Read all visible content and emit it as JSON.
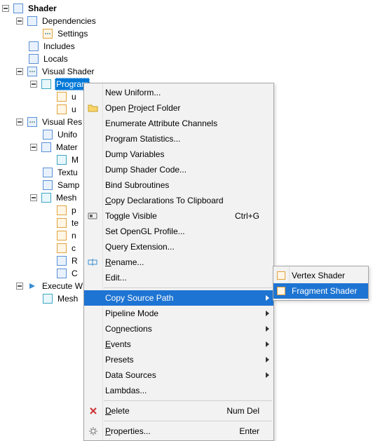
{
  "tree": {
    "root": "Shader",
    "dependencies": "Dependencies",
    "settings": "Settings",
    "includes": "Includes",
    "locals": "Locals",
    "visual_shader": "Visual Shader",
    "program": "Program",
    "u1": "u",
    "u2": "u",
    "visual_res": "Visual Res",
    "unifo": "Unifo",
    "mater": "Mater",
    "m": "M",
    "textu": "Textu",
    "samp": "Samp",
    "mesh1": "Mesh",
    "p": "p",
    "te": "te",
    "n": "n",
    "c": "c",
    "r": "R",
    "cap_c": "C",
    "execute_w": "Execute W",
    "mesh2": "Mesh"
  },
  "menu": {
    "new_uniform": "New Uniform...",
    "open_project_folder_pre": "Open ",
    "open_project_folder_u": "P",
    "open_project_folder_post": "roject Folder",
    "enumerate_attr": "Enumerate Attribute Channels",
    "program_stats": "Program Statistics...",
    "dump_vars": "Dump Variables",
    "dump_shader": "Dump Shader Code...",
    "bind_sub": "Bind Subroutines",
    "copy_decl_pre": "",
    "copy_decl_u": "C",
    "copy_decl_post": "opy Declarations To Clipboard",
    "toggle_visible": "Toggle Visible",
    "toggle_visible_accel": "Ctrl+G",
    "set_opengl": "Set OpenGL Profile...",
    "query_ext": "Query Extension...",
    "rename_u": "R",
    "rename_post": "ename...",
    "edit": "Edit...",
    "copy_source": "Copy Source Path",
    "pipeline": "Pipeline Mode",
    "connections_pre": "Co",
    "connections_u": "n",
    "connections_post": "nections",
    "events_u": "E",
    "events_post": "vents",
    "presets": "Presets",
    "data_sources": "Data Sources",
    "lambdas": "Lambdas...",
    "delete_u": "D",
    "delete_post": "elete",
    "delete_accel": "Num Del",
    "properties_u": "P",
    "properties_post": "roperties...",
    "properties_accel": "Enter"
  },
  "submenu": {
    "vertex": "Vertex Shader",
    "fragment": "Fragment Shader"
  }
}
